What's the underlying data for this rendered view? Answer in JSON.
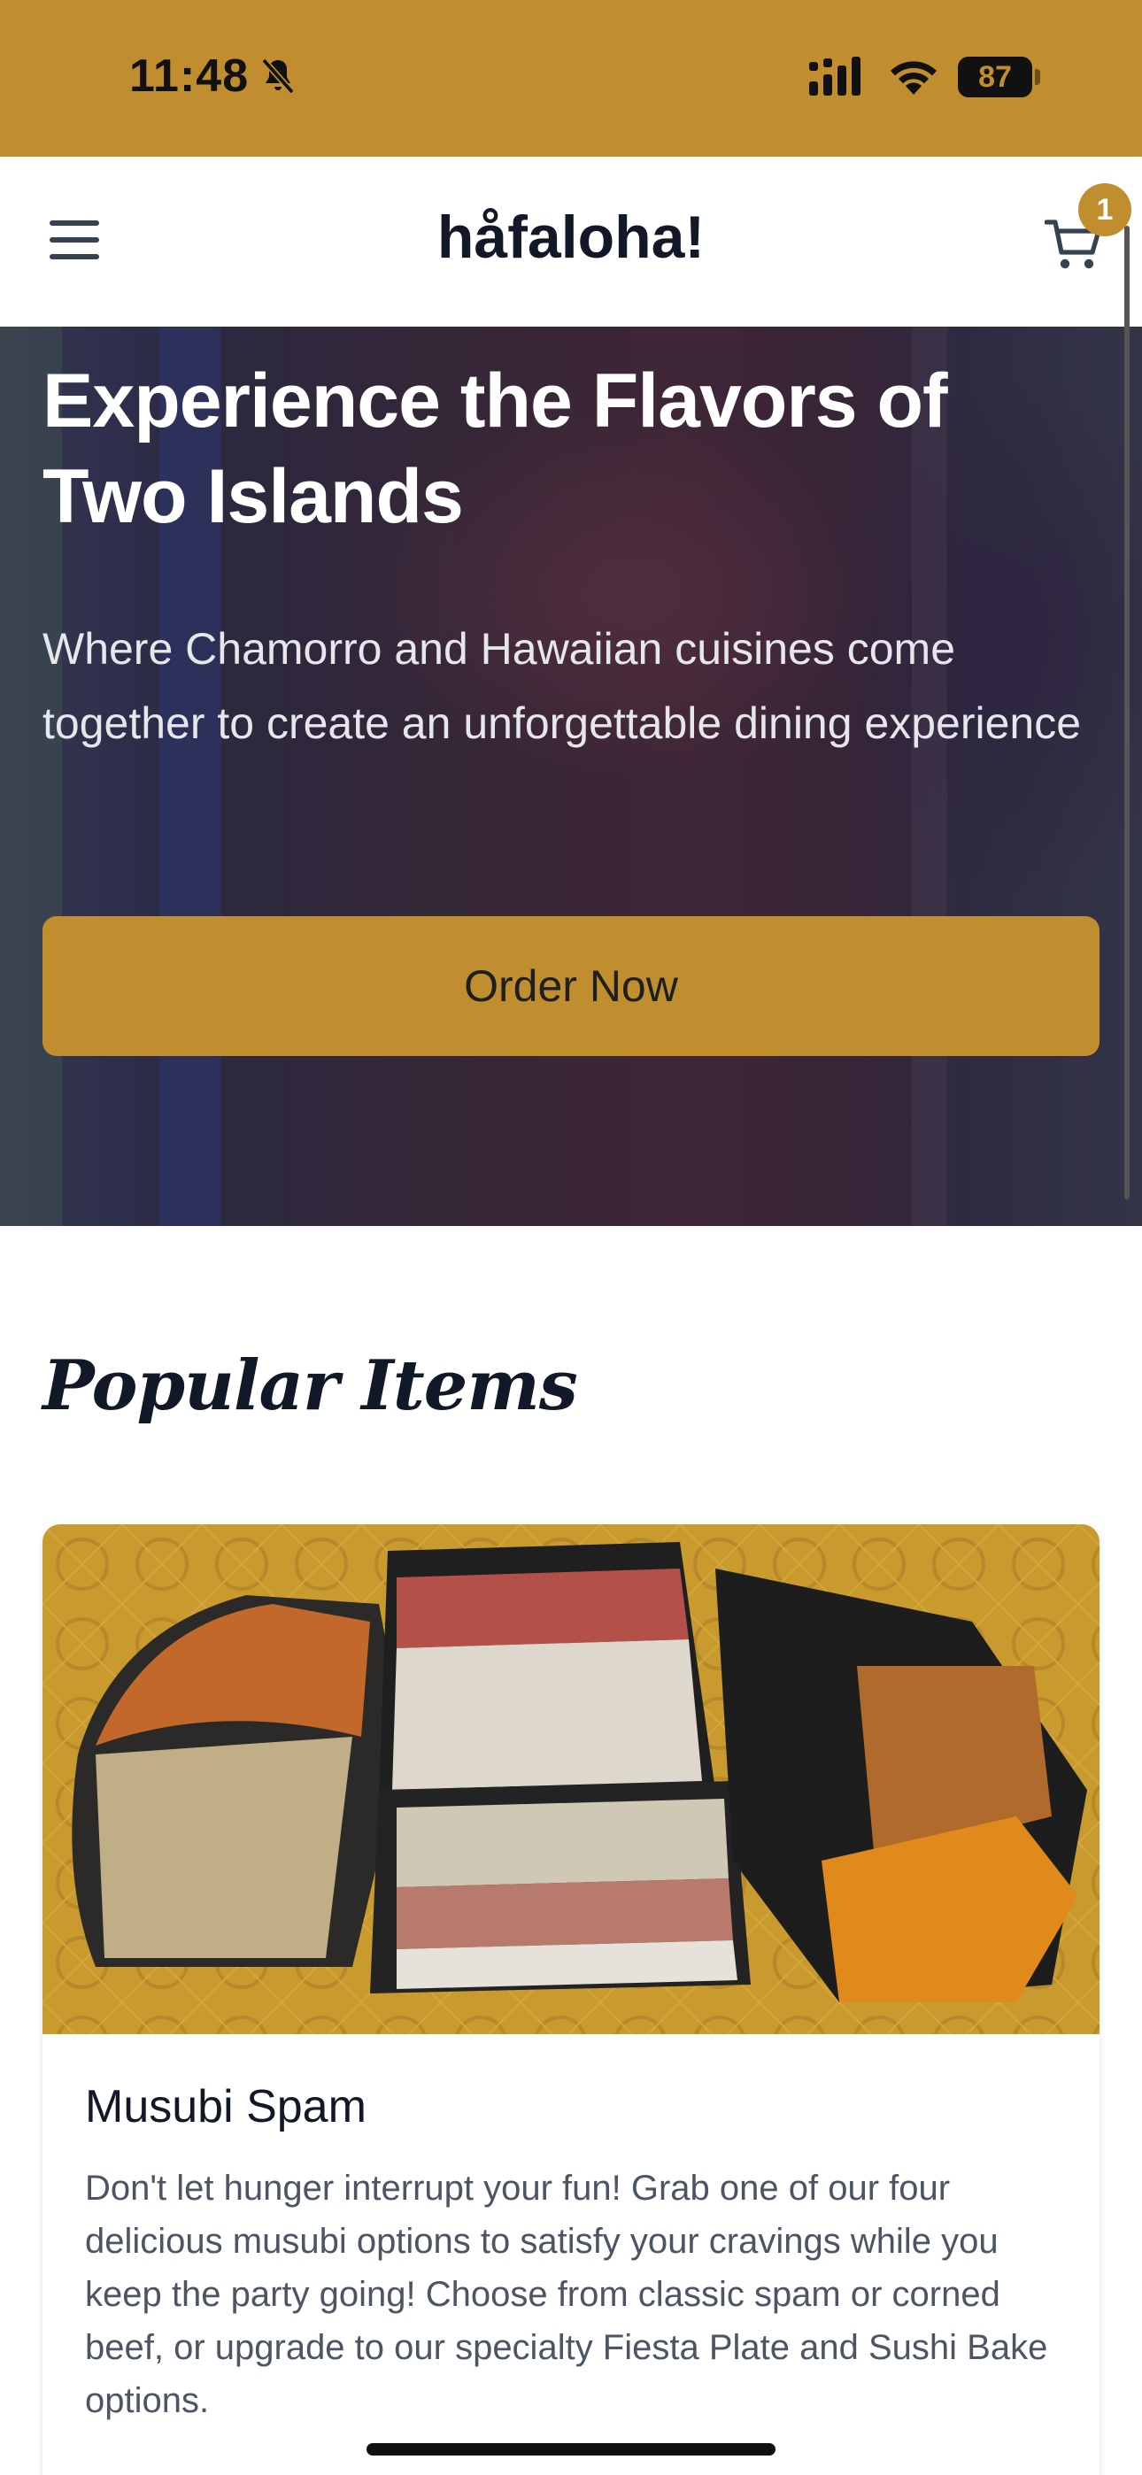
{
  "status_bar": {
    "time": "11:48",
    "battery": "87",
    "bell_icon": "bell-slash-icon",
    "signal_icon": "cellular-signal-icon",
    "wifi_icon": "wifi-icon"
  },
  "header": {
    "brand": "håfaloha!",
    "menu_icon": "hamburger-menu-icon",
    "cart_icon": "shopping-cart-icon",
    "cart_count": "1"
  },
  "hero": {
    "title": "Experience the Flavors of Two Islands",
    "subtitle": "Where Chamorro and Hawaiian cuisines come together to create an unforgettable dining experience",
    "cta_label": "Order Now"
  },
  "popular": {
    "heading": "Popular Items",
    "items": [
      {
        "name": "Musubi Spam",
        "description": "Don't let hunger interrupt your fun! Grab one of our four delicious musubi options to satisfy your cravings while you keep the party going!  Choose from classic spam or corned beef, or upgrade to our specialty Fiesta Plate and Sushi Bake options."
      }
    ]
  },
  "colors": {
    "accent": "#c08e2f",
    "text_dark": "#111827",
    "text_muted": "#4b5563"
  }
}
